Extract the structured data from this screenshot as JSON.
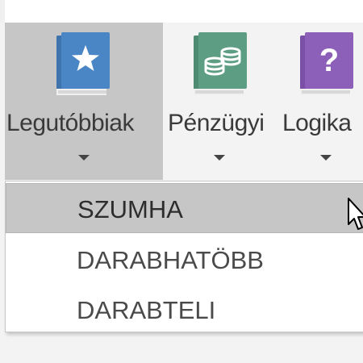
{
  "ribbon": {
    "buttons": [
      {
        "label": "Legutóbbiak",
        "icon": "book-star-icon",
        "color": "#4a86c5",
        "active": true
      },
      {
        "label": "Pénzügyi",
        "icon": "book-coins-icon",
        "color": "#5c9d84",
        "active": false
      },
      {
        "label": "Logika",
        "icon": "book-question-icon",
        "color": "#8c5fb8",
        "active": false
      }
    ]
  },
  "menu": {
    "items": [
      {
        "label": "SZUMHA",
        "highlighted": true
      },
      {
        "label": "DARABHATÖBB",
        "highlighted": false
      },
      {
        "label": "DARABTELI",
        "highlighted": false
      }
    ]
  },
  "colors": {
    "ribbon_bg": "#f3f3f3",
    "active_bg": "#c6c6c6",
    "menu_bg": "#ffffff",
    "text": "#3a3a3a"
  }
}
